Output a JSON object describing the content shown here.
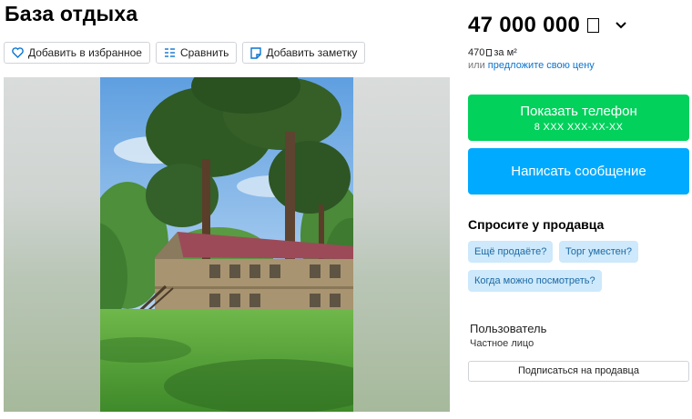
{
  "listing": {
    "title": "База отдыха"
  },
  "actions": {
    "favorite_label": "Добавить в избранное",
    "compare_label": "Сравнить",
    "note_label": "Добавить заметку"
  },
  "price": {
    "amount": "47 000 000",
    "per_m2_amount": "470",
    "per_m2_suffix": "за м²",
    "offer_prefix": "или",
    "offer_link": "предложите свою цену"
  },
  "contact": {
    "phone_label": "Показать телефон",
    "phone_masked": "8 XXX XXX-XX-XX",
    "message_label": "Написать сообщение"
  },
  "ask": {
    "title": "Спросите у продавца",
    "questions": [
      "Ещё продаёте?",
      "Торг уместен?",
      "Когда можно посмотреть?"
    ]
  },
  "seller": {
    "name": "Пользователь",
    "type": "Частное лицо",
    "subscribe_label": "Подписаться на продавца"
  },
  "colors": {
    "phone_button": "#02d15c",
    "message_button": "#00aaff",
    "chip_bg": "#cde9fb",
    "link": "#0a74d1"
  },
  "icons": [
    "heart-icon",
    "compare-icon",
    "note-icon",
    "chevron-down-icon",
    "ruble-icon"
  ]
}
